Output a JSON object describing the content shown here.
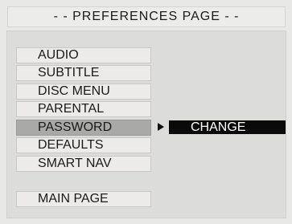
{
  "header": {
    "title": "- - PREFERENCES PAGE - -"
  },
  "menu": {
    "items": [
      {
        "label": "AUDIO"
      },
      {
        "label": "SUBTITLE"
      },
      {
        "label": "DISC MENU"
      },
      {
        "label": "PARENTAL"
      },
      {
        "label": "PASSWORD",
        "selected": true
      },
      {
        "label": "DEFAULTS"
      },
      {
        "label": "SMART NAV"
      }
    ],
    "main_page": {
      "label": "MAIN PAGE"
    }
  },
  "submenu": {
    "selected_label": "CHANGE"
  },
  "colors": {
    "background": "#e8e8e6",
    "selected_item": "#a9a9a7",
    "submenu_highlight": "#0a0a0a"
  }
}
